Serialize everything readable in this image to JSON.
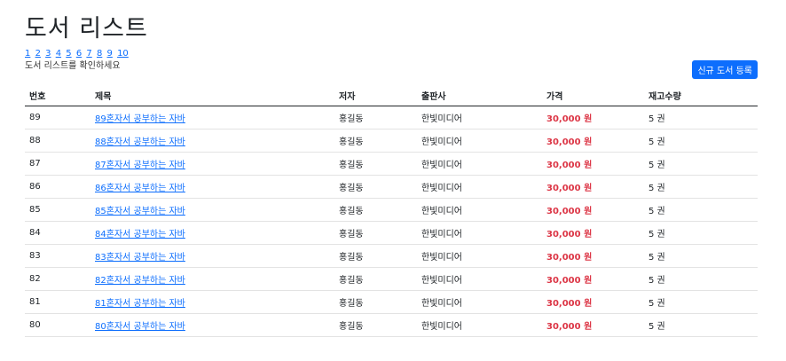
{
  "page": {
    "title": "도서 리스트",
    "subtitle": "도서 리스트를 확인하세요"
  },
  "pager": [
    "1",
    "2",
    "3",
    "4",
    "5",
    "6",
    "7",
    "8",
    "9",
    "10"
  ],
  "new_button_label": "신규 도서 등록",
  "table": {
    "headers": [
      "번호",
      "제목",
      "저자",
      "출판사",
      "가격",
      "재고수량"
    ],
    "rows": [
      {
        "no": "89",
        "title": "89혼자서 공부하는 자바",
        "author": "홍길동",
        "publisher": "한빛미디어",
        "price": "30,000 원",
        "stock": "5 권"
      },
      {
        "no": "88",
        "title": "88혼자서 공부하는 자바",
        "author": "홍길동",
        "publisher": "한빛미디어",
        "price": "30,000 원",
        "stock": "5 권"
      },
      {
        "no": "87",
        "title": "87혼자서 공부하는 자바",
        "author": "홍길동",
        "publisher": "한빛미디어",
        "price": "30,000 원",
        "stock": "5 권"
      },
      {
        "no": "86",
        "title": "86혼자서 공부하는 자바",
        "author": "홍길동",
        "publisher": "한빛미디어",
        "price": "30,000 원",
        "stock": "5 권"
      },
      {
        "no": "85",
        "title": "85혼자서 공부하는 자바",
        "author": "홍길동",
        "publisher": "한빛미디어",
        "price": "30,000 원",
        "stock": "5 권"
      },
      {
        "no": "84",
        "title": "84혼자서 공부하는 자바",
        "author": "홍길동",
        "publisher": "한빛미디어",
        "price": "30,000 원",
        "stock": "5 권"
      },
      {
        "no": "83",
        "title": "83혼자서 공부하는 자바",
        "author": "홍길동",
        "publisher": "한빛미디어",
        "price": "30,000 원",
        "stock": "5 권"
      },
      {
        "no": "82",
        "title": "82혼자서 공부하는 자바",
        "author": "홍길동",
        "publisher": "한빛미디어",
        "price": "30,000 원",
        "stock": "5 권"
      },
      {
        "no": "81",
        "title": "81혼자서 공부하는 자바",
        "author": "홍길동",
        "publisher": "한빛미디어",
        "price": "30,000 원",
        "stock": "5 권"
      },
      {
        "no": "80",
        "title": "80혼자서 공부하는 자바",
        "author": "홍길동",
        "publisher": "한빛미디어",
        "price": "30,000 원",
        "stock": "5 권"
      }
    ]
  },
  "colors": {
    "link": "#0d6efd",
    "price": "#dc3545",
    "button": "#0d6efd"
  }
}
